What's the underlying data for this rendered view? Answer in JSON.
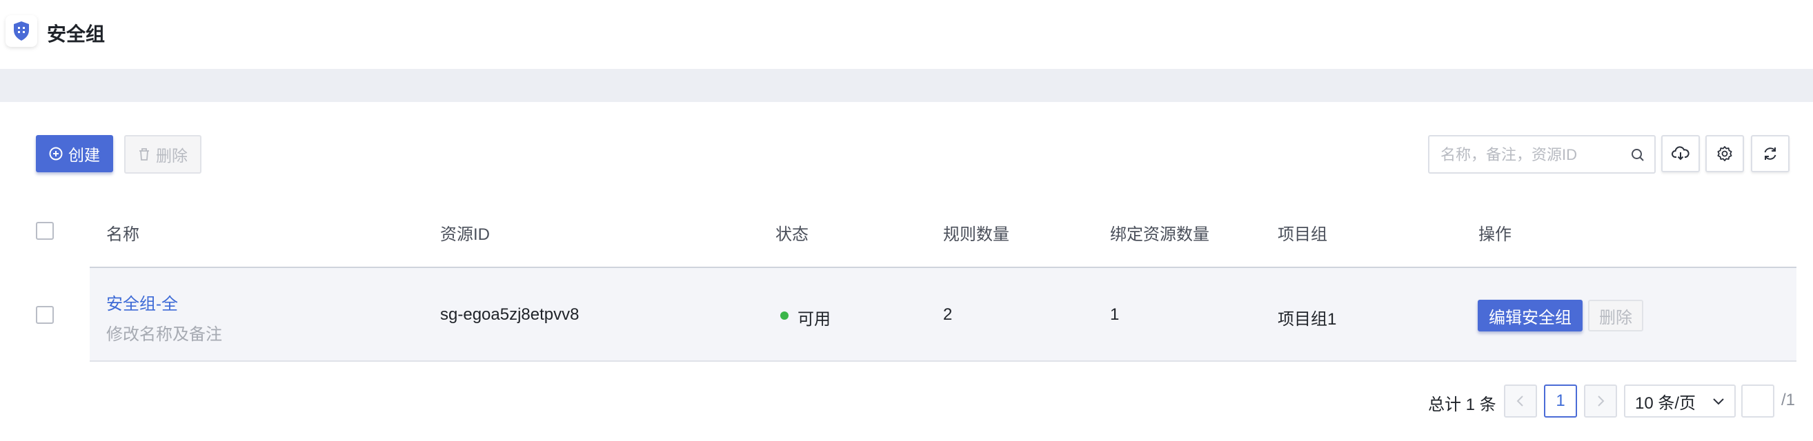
{
  "header": {
    "title": "安全组"
  },
  "toolbar": {
    "create_label": "创建",
    "delete_label": "删除",
    "search_placeholder": "名称，备注，资源ID"
  },
  "table": {
    "columns": [
      "名称",
      "资源ID",
      "状态",
      "规则数量",
      "绑定资源数量",
      "项目组",
      "操作"
    ],
    "rows": [
      {
        "name": "安全组-全",
        "note": "修改名称及备注",
        "resource_id": "sg-egoa5zj8etpvv8",
        "status": "可用",
        "rule_count": "2",
        "bound_count": "1",
        "project": "项目组1",
        "edit_label": "编辑安全组",
        "delete_label": "删除"
      }
    ]
  },
  "pagination": {
    "total": "总计 1 条",
    "current_page": "1",
    "page_size": "10 条/页",
    "jump_value": "",
    "total_pages": "/1"
  },
  "colors": {
    "primary": "#4a6bd6",
    "link": "#3d6ad6",
    "status_ok": "#3bb54a"
  }
}
